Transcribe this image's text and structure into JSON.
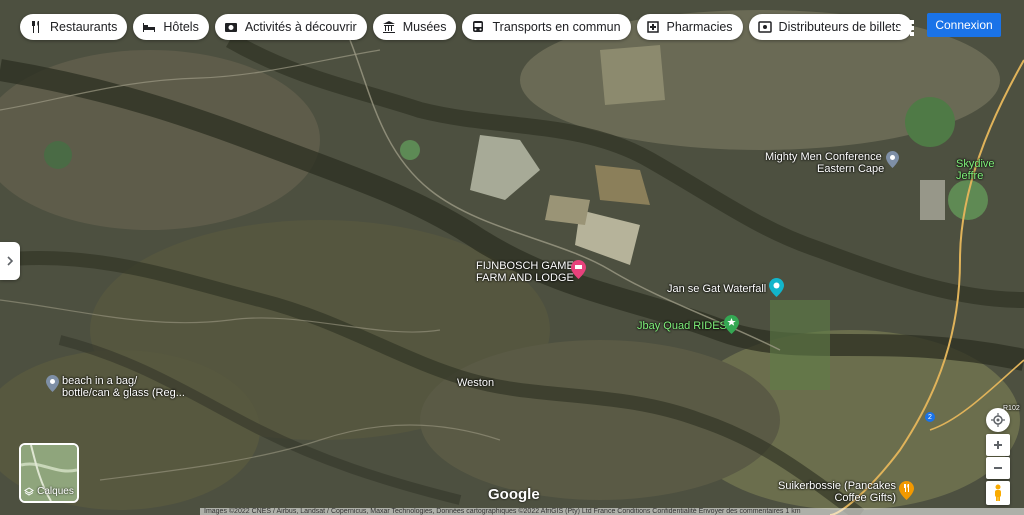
{
  "chips": [
    {
      "label": "Restaurants",
      "icon": "fork-knife-icon"
    },
    {
      "label": "Hôtels",
      "icon": "bed-icon"
    },
    {
      "label": "Activités à découvrir",
      "icon": "camera-icon"
    },
    {
      "label": "Musées",
      "icon": "museum-icon"
    },
    {
      "label": "Transports en commun",
      "icon": "bus-icon"
    },
    {
      "label": "Pharmacies",
      "icon": "pharmacy-icon"
    },
    {
      "label": "Distributeurs de billets",
      "icon": "atm-icon"
    }
  ],
  "signin_label": "Connexion",
  "places": {
    "mighty_1": "Mighty Men Conference",
    "mighty_2": "Eastern Cape",
    "skydive": "Skydive Jeffre",
    "fijnbosch_1": "FIJNBOSCH GAME",
    "fijnbosch_2": "FARM AND LODGE",
    "waterfall": "Jan se Gat Waterfall",
    "jbay": "Jbay Quad RIDES",
    "weston": "Weston",
    "beach_1": "beach in a bag/",
    "beach_2": "bottle/can & glass (Reg...",
    "suiker_1": "Suikerbossie (Pancakes",
    "suiker_2": "Coffee Gifts)"
  },
  "road_badge": "2",
  "road_label": "R102",
  "layers_label": "Calques",
  "logo": "Google",
  "footer": "Images ©2022 CNES / Airbus, Landsat / Copernicus, Maxar Technologies, Données cartographiques ©2022 AfriGIS (Pty) Ltd   France   Conditions   Confidentialité   Envoyer des commentaires   1 km",
  "colors": {
    "accent": "#1a73e8",
    "pink_pin": "#e8417c",
    "green_pin": "#34a853",
    "orange_pin": "#f29900",
    "teal_pin": "#12b5cb"
  }
}
